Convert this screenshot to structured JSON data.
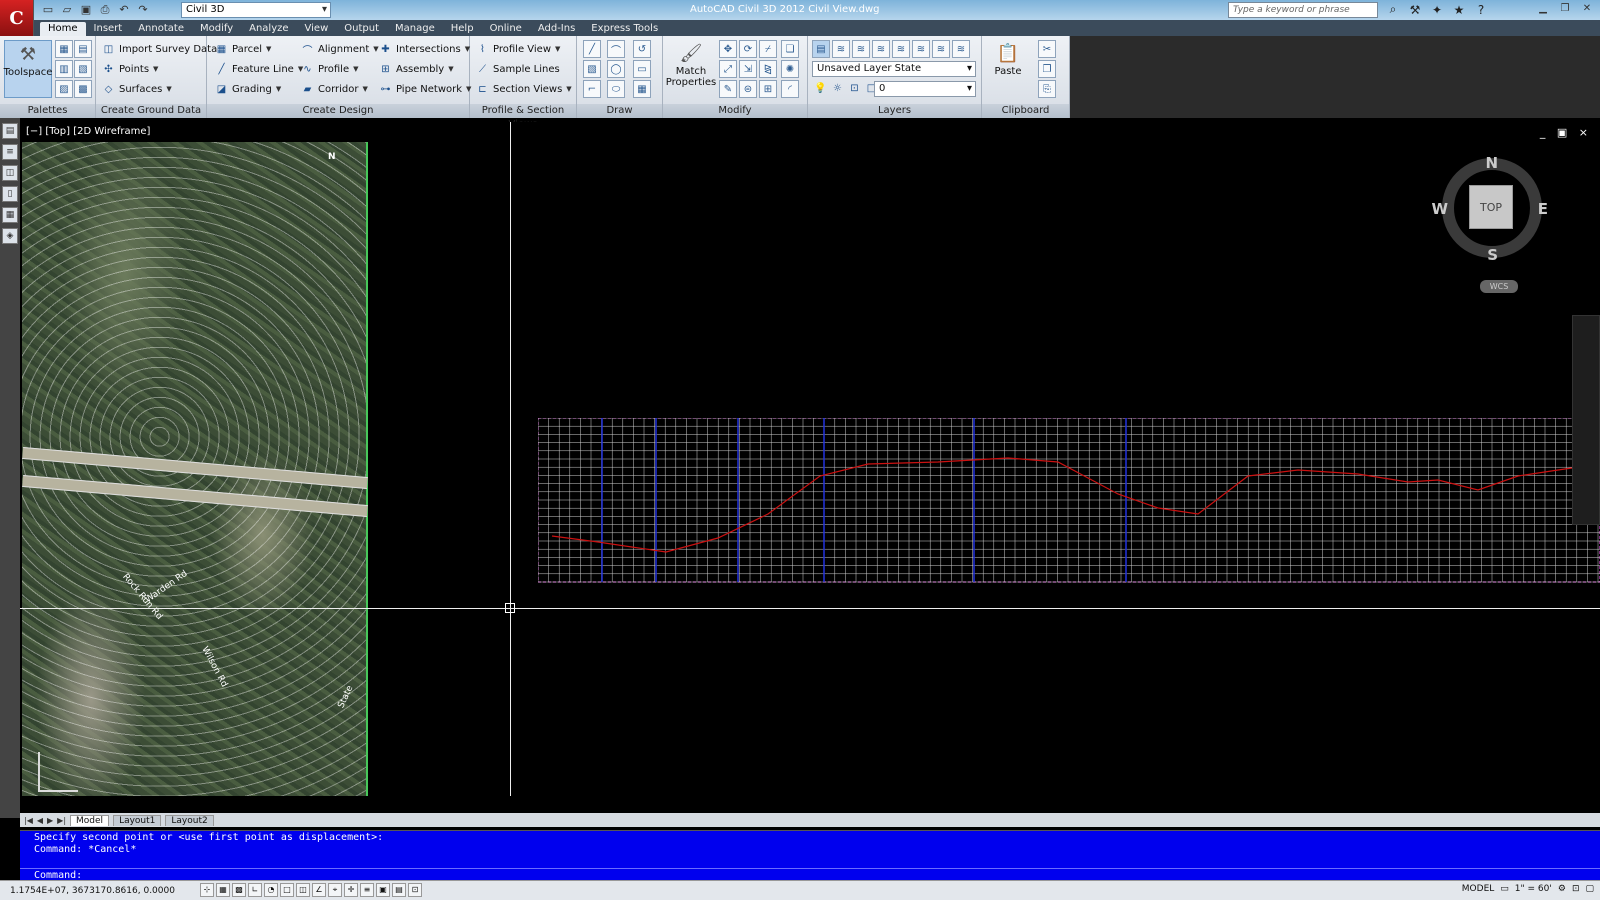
{
  "app": {
    "title": "AutoCAD Civil 3D 2012    Civil View.dwg",
    "workspace": "Civil 3D",
    "search_placeholder": "Type a keyword or phrase"
  },
  "tabs": [
    "Home",
    "Insert",
    "Annotate",
    "Modify",
    "Analyze",
    "View",
    "Output",
    "Manage",
    "Help",
    "Online",
    "Add-Ins",
    "Express Tools"
  ],
  "ribbon": {
    "palettes": {
      "label": "Palettes",
      "toolspace": "Toolspace"
    },
    "ground": {
      "label": "Create Ground Data",
      "import": "Import Survey Data",
      "points": "Points",
      "surfaces": "Surfaces"
    },
    "design": {
      "label": "Create Design",
      "parcel": "Parcel",
      "feature_line": "Feature Line",
      "grading": "Grading",
      "alignment": "Alignment",
      "profile": "Profile",
      "corridor": "Corridor",
      "intersections": "Intersections",
      "assembly": "Assembly",
      "pipe_network": "Pipe Network"
    },
    "profile_views": {
      "label": "Profile & Section Views",
      "profile_view": "Profile View",
      "sample_lines": "Sample Lines",
      "section_views": "Section Views"
    },
    "draw": {
      "label": "Draw"
    },
    "modify": {
      "label": "Modify",
      "match": "Match Properties"
    },
    "layers": {
      "label": "Layers",
      "layer_state": "Unsaved Layer State",
      "layer": "0"
    },
    "clipboard": {
      "label": "Clipboard",
      "paste": "Paste"
    }
  },
  "viewport": {
    "label": "[−] [Top] [2D Wireframe]",
    "controls": "_ ▣ ×"
  },
  "viewcube": {
    "top": "TOP",
    "north": "N",
    "south": "S",
    "east": "E",
    "west": "W",
    "wcs": "WCS"
  },
  "map_labels": {
    "rock_run": "Rock Run Rd",
    "warden": "Warden Rd",
    "wilson": "Wilson Rd",
    "state": "State",
    "n_label": "N"
  },
  "layout_tabs": [
    "Model",
    "Layout1",
    "Layout2"
  ],
  "command": {
    "line1": "Specify second point or <use first point as displacement>:",
    "line2": "Command: *Cancel*",
    "prompt": "Command:"
  },
  "status": {
    "coords": "1.1754E+07, 3673170.8616, 0.0000",
    "model": "MODEL",
    "scale": "1\" = 60'"
  },
  "colors": {
    "accent": "#0000ee",
    "profile_line": "#cc1111",
    "grid": "#cfcfcf"
  }
}
